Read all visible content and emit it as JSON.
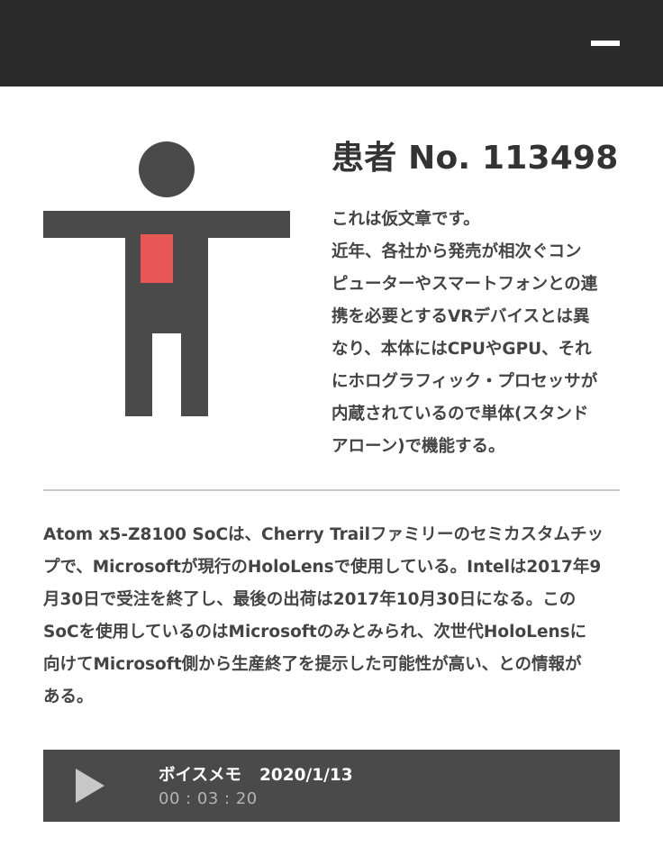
{
  "header": {
    "menu_icon": "minus-icon",
    "background": "#2b2b2b"
  },
  "patient": {
    "title": "患者 No. 113498",
    "description_lines": [
      "これは仮文章です。",
      "近年、各社から発売が相次ぐコン",
      "ピューターやスマートフォンとの連",
      "携を必要とするVRデバイスとは異",
      "なり、本体にはCPUやGPU、それ",
      "にホログラフィック・プロセッサが",
      "内蔵されているので単体(スタンド",
      "アローン)で機能する。"
    ],
    "figure_colors": {
      "body": "#4a4a4a",
      "highlight": "#e85656"
    }
  },
  "article": {
    "lines": [
      "Atom x5-Z8100 SoCは、Cherry Trailファミリーのセミカスタムチッ",
      "プで、Microsoftが現行のHoloLensで使用している。Intelは2017年9",
      "月30日で受注を終了し、最後の出荷は2017年10月30日になる。この",
      "SoCを使用しているのはMicrosoftのみとみられ、次世代HoloLensに",
      "向けてMicrosoft側から生産終了を提示した可能性が高い、との情報が",
      "ある。"
    ]
  },
  "voice_memo": {
    "play_icon": "play-icon",
    "label": "ボイスメモ",
    "date": "2020/1/13",
    "duration": "00 : 03 : 20"
  }
}
